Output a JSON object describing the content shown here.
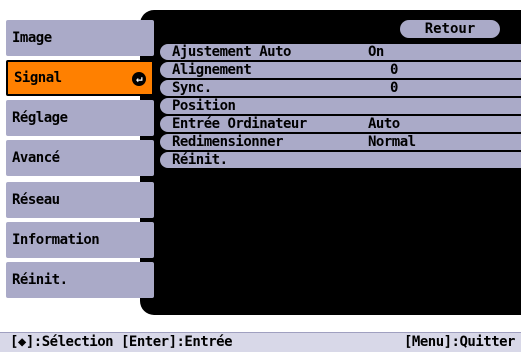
{
  "menu": {
    "items": [
      {
        "label": "Image"
      },
      {
        "label": "Signal"
      },
      {
        "label": "Réglage"
      },
      {
        "label": "Avancé"
      },
      {
        "label": "Réseau"
      },
      {
        "label": "Information"
      },
      {
        "label": "Réinit."
      }
    ],
    "active_index": 1,
    "enter_glyph": "↵"
  },
  "submenu": {
    "back_label": "Retour",
    "options": [
      {
        "label": "Ajustement Auto",
        "value": "On"
      },
      {
        "label": "Alignement",
        "value": "0"
      },
      {
        "label": "Sync.",
        "value": "0"
      },
      {
        "label": "Position",
        "value": ""
      },
      {
        "label": "Entrée Ordinateur",
        "value": "Auto"
      },
      {
        "label": "Redimensionner",
        "value": "Normal"
      },
      {
        "label": "Réinit.",
        "value": ""
      }
    ]
  },
  "footer": {
    "left": "[◆]:Sélection [Enter]:Entrée",
    "right": "[Menu]:Quitter"
  },
  "colors": {
    "accent": "#ff8000",
    "item_bg": "#aaaac8",
    "panel_bg": "#000000"
  }
}
